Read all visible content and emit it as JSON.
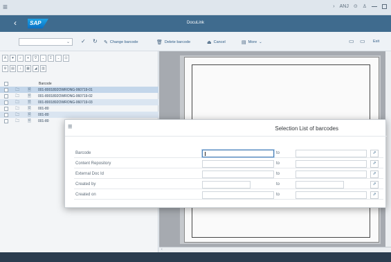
{
  "window": {
    "app_title": "DocuLink",
    "logo_text": "SAP",
    "system_right": [
      "ANJ"
    ]
  },
  "toolbar": {
    "change_barcode": "Change barcode",
    "delete_barcode": "Delete barcode",
    "cancel": "Cancel",
    "more": "More",
    "exit": "Exit"
  },
  "tree": {
    "header": "Barcode",
    "items": [
      "001-8001892OWRONG-060719-01",
      "001-8001892OWRONG-060719-02",
      "001-8001892OWRONG-060719-03",
      "001-80",
      "001-80",
      "001-80"
    ]
  },
  "dialog": {
    "title": "Selection List of barcodes",
    "to_label": "to",
    "fields": [
      {
        "label": "Barcode"
      },
      {
        "label": "Content Repository"
      },
      {
        "label": "External Doc Id"
      },
      {
        "label": "Created by"
      },
      {
        "label": "Created on"
      }
    ]
  },
  "colors": {
    "title_bar": "#3f6b8e",
    "selection": "#c3d6ea",
    "footer": "#2b3d4f"
  }
}
